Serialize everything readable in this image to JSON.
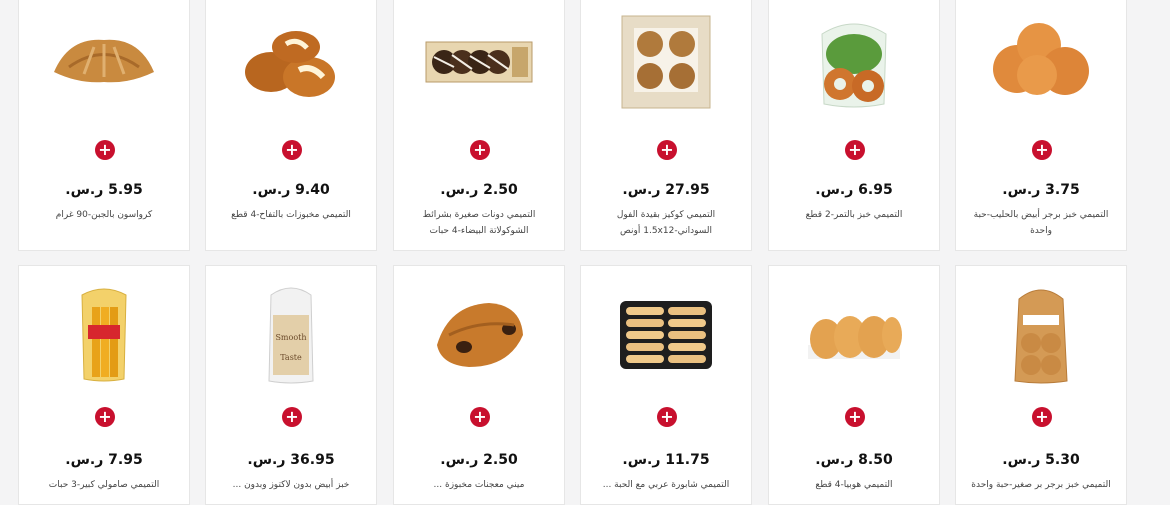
{
  "currency": "ر.س.",
  "colors": {
    "accent": "#c8102e",
    "card_bg": "#ffffff",
    "page_bg": "#f4f4f5"
  },
  "products": [
    {
      "name": "كرواسون بالجبن-90 غرام",
      "price": "5.95",
      "image": "croissant-image"
    },
    {
      "name": "التميمي مخبوزات بالتفاح-4 قطع",
      "price": "9.40",
      "image": "apple-pastries-image"
    },
    {
      "name": "التميمي دونات صغيرة بشرائط الشوكولاتة البيضاء-4 حبات",
      "price": "2.50",
      "image": "mini-donuts-image"
    },
    {
      "name": "التميمي كوكيز بقيدة الفول السوداني-1.5x12 أونص",
      "price": "27.95",
      "image": "cookies-box-image"
    },
    {
      "name": "التميمي خبز بالتمر-2 قطع",
      "price": "6.95",
      "image": "date-bread-image"
    },
    {
      "name": "التميمي خبز برجر أبيض بالحليب-حبة واحدة",
      "price": "3.75",
      "image": "burger-buns-image"
    },
    {
      "name": "التميمي صامولي كبير-3 حبات",
      "price": "7.95",
      "image": "samoli-bread-image"
    },
    {
      "name": "خبز أبيض بدون لاكتوز وبدون ...",
      "price": "36.95",
      "image": "lactose-free-bread-image"
    },
    {
      "name": "ميني معجنات مخبوزة ...",
      "price": "2.50",
      "image": "chocolate-pastry-image"
    },
    {
      "name": "التميمي شابورة عربي مع الحبة ...",
      "price": "11.75",
      "image": "rusk-tray-image"
    },
    {
      "name": "التميمي هوبيا-4 قطع",
      "price": "8.50",
      "image": "hopia-image"
    },
    {
      "name": "التميمي خبز برجر بر صغير-حبة واحدة",
      "price": "5.30",
      "image": "small-buns-bag-image"
    }
  ]
}
